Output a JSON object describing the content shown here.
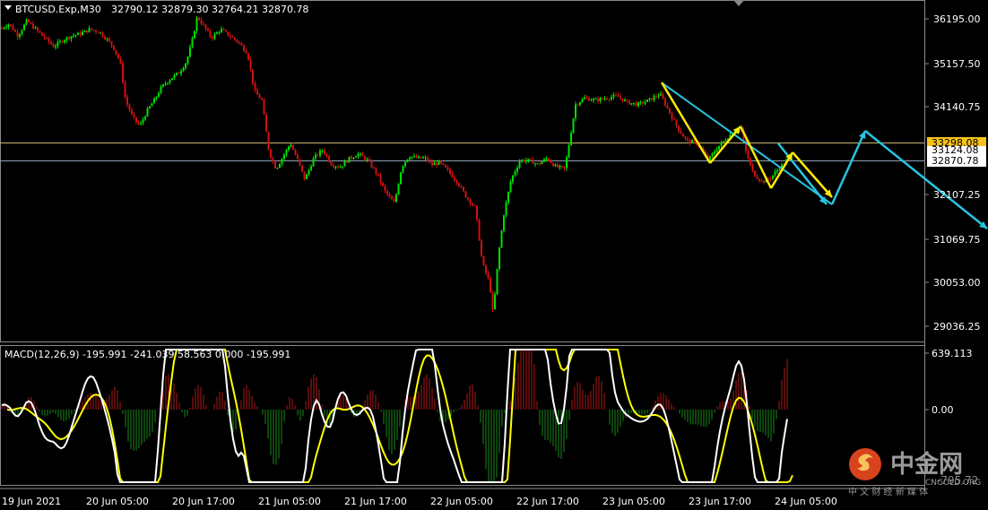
{
  "main_header": {
    "dropdown_icon": "triangle-down-icon",
    "symbol": "BTCUSD.Exp,M30",
    "ohlc": "32790.12 32879.30 32764.21 32870.78"
  },
  "macd_header": "MACD(12,26,9) -195.991 -241.039 58.563 0.000 -195.991",
  "price_axis": {
    "ticks": [
      "36195.00",
      "35157.50",
      "34140.75",
      "32107.25",
      "31069.75",
      "30053.00",
      "29036.25"
    ],
    "labels": [
      {
        "text": "33298.08",
        "bg": "#f7c21a",
        "fg": "#000000"
      },
      {
        "text": "33124.08",
        "bg": "#ffffff",
        "fg": "#000000"
      },
      {
        "text": "32870.78",
        "bg": "#ffffff",
        "fg": "#000000"
      }
    ]
  },
  "macd_axis": {
    "ticks": [
      "639.113",
      "0.00",
      "-795.72"
    ]
  },
  "time_axis": {
    "ticks": [
      "19 Jun 2021",
      "20 Jun 05:00",
      "20 Jun 17:00",
      "21 Jun 05:00",
      "21 Jun 17:00",
      "22 Jun 05:00",
      "22 Jun 17:00",
      "23 Jun 05:00",
      "23 Jun 17:00",
      "24 Jun 05:00"
    ]
  },
  "watermark": {
    "name": "中金网",
    "domain": "CNGOLD.ORG",
    "slogan": "中 文 财 经 新 媒 体"
  },
  "colors": {
    "bull": "#00e000",
    "bear": "#d01010",
    "grid": "#555555",
    "signal": "#ffff00",
    "macd_line": "#ffffff",
    "hist_pos": "#b01818",
    "hist_neg": "#1a8a1a",
    "trend": "#27c4e0",
    "zigzag": "#ffea00",
    "h_line": "#c8b46e",
    "bid_line": "#8fa3b5"
  },
  "chart_data": [
    {
      "type": "candlestick",
      "title": "BTCUSD.Exp,M30",
      "last_ohlc": {
        "open": 32790.12,
        "high": 32879.3,
        "low": 32764.21,
        "close": 32870.78
      },
      "ylim": [
        28600,
        36700
      ],
      "x_ticks": [
        "19 Jun 2021",
        "20 Jun 05:00",
        "20 Jun 17:00",
        "21 Jun 05:00",
        "21 Jun 17:00",
        "22 Jun 05:00",
        "22 Jun 17:00",
        "23 Jun 05:00",
        "23 Jun 17:00",
        "24 Jun 05:00"
      ],
      "path": [
        [
          0,
          35950
        ],
        [
          10,
          36080
        ],
        [
          20,
          35800
        ],
        [
          30,
          36150
        ],
        [
          40,
          35950
        ],
        [
          50,
          35750
        ],
        [
          60,
          35550
        ],
        [
          70,
          35700
        ],
        [
          80,
          35800
        ],
        [
          90,
          35850
        ],
        [
          100,
          35950
        ],
        [
          110,
          35900
        ],
        [
          118,
          35750
        ],
        [
          126,
          35550
        ],
        [
          134,
          35200
        ],
        [
          140,
          34300
        ],
        [
          148,
          33900
        ],
        [
          156,
          33700
        ],
        [
          164,
          34050
        ],
        [
          172,
          34300
        ],
        [
          180,
          34600
        ],
        [
          190,
          34800
        ],
        [
          200,
          34950
        ],
        [
          208,
          35200
        ],
        [
          214,
          35650
        ],
        [
          220,
          36250
        ],
        [
          228,
          36000
        ],
        [
          236,
          35750
        ],
        [
          246,
          35950
        ],
        [
          256,
          35800
        ],
        [
          266,
          35650
        ],
        [
          276,
          35400
        ],
        [
          284,
          34500
        ],
        [
          292,
          34300
        ],
        [
          300,
          33100
        ],
        [
          308,
          32700
        ],
        [
          316,
          33000
        ],
        [
          324,
          33300
        ],
        [
          332,
          32900
        ],
        [
          340,
          32450
        ],
        [
          350,
          32950
        ],
        [
          360,
          33150
        ],
        [
          370,
          32800
        ],
        [
          380,
          32750
        ],
        [
          390,
          32950
        ],
        [
          400,
          33050
        ],
        [
          410,
          32900
        ],
        [
          420,
          32600
        ],
        [
          430,
          32150
        ],
        [
          440,
          31900
        ],
        [
          448,
          32750
        ],
        [
          456,
          33000
        ],
        [
          466,
          32950
        ],
        [
          474,
          32950
        ],
        [
          482,
          32800
        ],
        [
          490,
          32850
        ],
        [
          500,
          32650
        ],
        [
          510,
          32400
        ],
        [
          520,
          32050
        ],
        [
          530,
          31800
        ],
        [
          538,
          30500
        ],
        [
          546,
          30050
        ],
        [
          550,
          29300
        ],
        [
          556,
          30700
        ],
        [
          562,
          31650
        ],
        [
          570,
          32450
        ],
        [
          580,
          32900
        ],
        [
          590,
          32900
        ],
        [
          600,
          32800
        ],
        [
          610,
          32950
        ],
        [
          620,
          32750
        ],
        [
          630,
          32700
        ],
        [
          638,
          33700
        ],
        [
          642,
          34200
        ],
        [
          652,
          34350
        ],
        [
          664,
          34300
        ],
        [
          676,
          34350
        ],
        [
          688,
          34400
        ],
        [
          700,
          34250
        ],
        [
          712,
          34200
        ],
        [
          724,
          34300
        ],
        [
          736,
          34450
        ],
        [
          746,
          34050
        ],
        [
          756,
          33650
        ],
        [
          766,
          33350
        ],
        [
          778,
          33300
        ],
        [
          790,
          32900
        ],
        [
          800,
          33200
        ],
        [
          810,
          33400
        ],
        [
          820,
          33600
        ],
        [
          826,
          33700
        ],
        [
          832,
          33100
        ],
        [
          840,
          32600
        ],
        [
          850,
          32400
        ],
        [
          860,
          32500
        ],
        [
          868,
          32700
        ],
        [
          876,
          32850
        ],
        [
          878,
          32870
        ]
      ]
    },
    {
      "type": "line",
      "title": "MACD(12,26,9)",
      "ylim": [
        -795.72,
        639.113
      ],
      "values": {
        "macd": -195.991,
        "signal": -241.039,
        "histogram": 58.563
      }
    }
  ]
}
